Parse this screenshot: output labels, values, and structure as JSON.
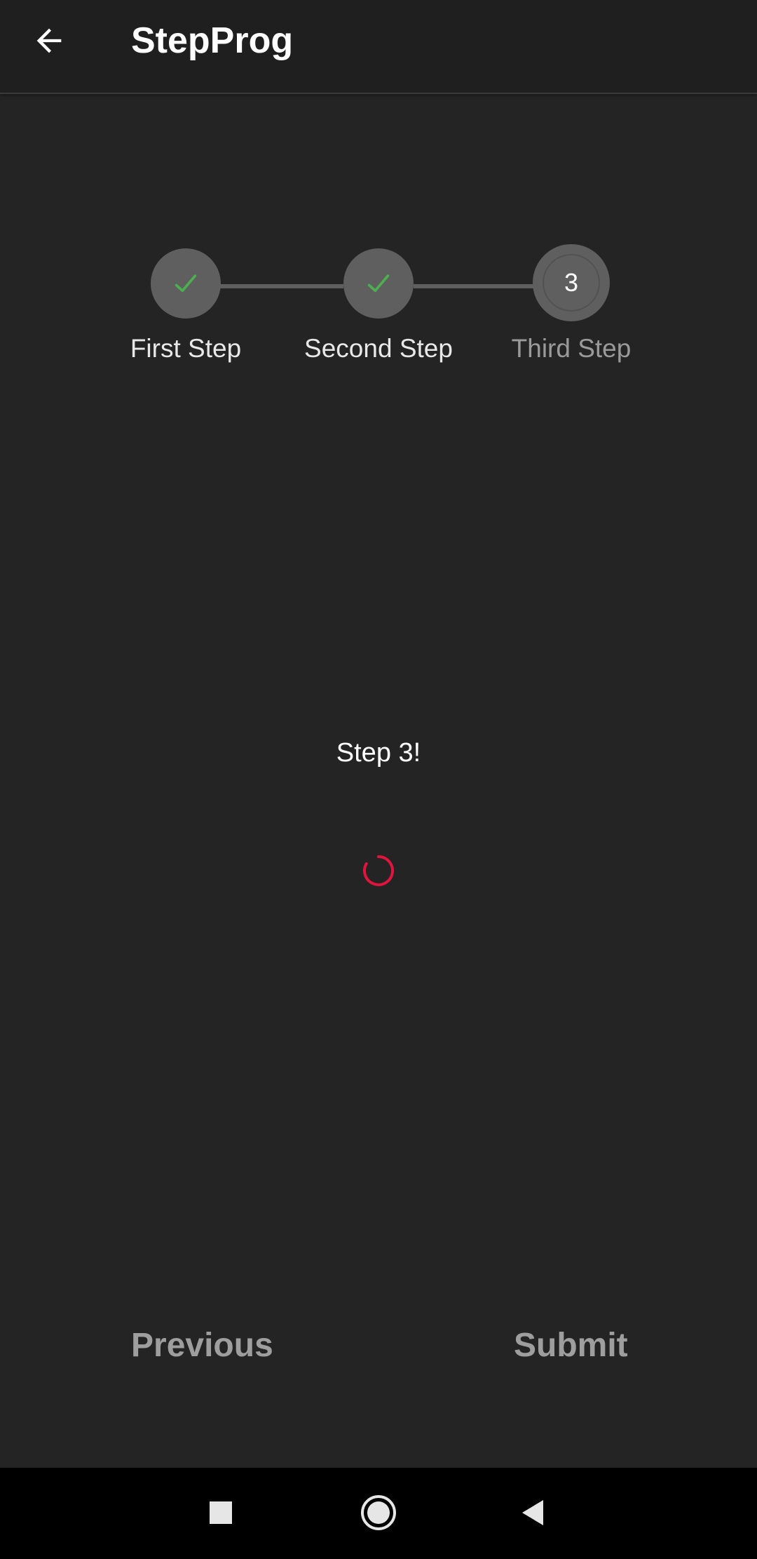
{
  "app_bar": {
    "title": "StepProg",
    "back_icon": "arrow-back-icon"
  },
  "stepper": {
    "steps": [
      {
        "label": "First Step",
        "state": "completed",
        "icon": "check-icon"
      },
      {
        "label": "Second Step",
        "state": "completed",
        "icon": "check-icon"
      },
      {
        "label": "Third Step",
        "state": "active",
        "number": "3"
      }
    ],
    "colors": {
      "check": "#4caf50",
      "circle": "#5f5f5f",
      "connector": "#5f5f5f"
    }
  },
  "content": {
    "message": "Step 3!",
    "spinner_icon": "loading-spinner-icon",
    "spinner_color": "#e0143c"
  },
  "actions": {
    "previous_label": "Previous",
    "submit_label": "Submit"
  },
  "system_nav": {
    "recents_icon": "square-recents-icon",
    "home_icon": "circle-home-icon",
    "back_icon": "triangle-back-icon"
  }
}
